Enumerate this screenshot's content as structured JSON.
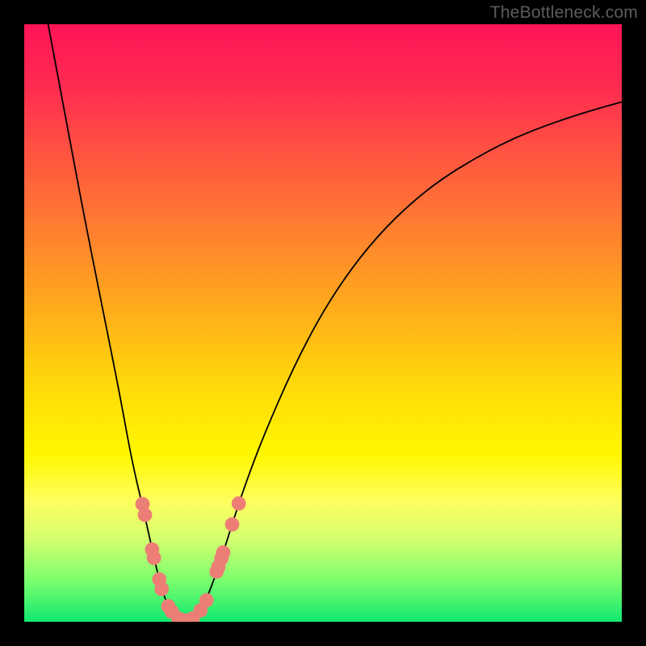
{
  "watermark": "TheBottleneck.com",
  "colors": {
    "frame": "#000000",
    "curve_stroke": "#000000",
    "marker_fill": "#ed7e76",
    "gradient_stops": [
      "#ff1456",
      "#ff2a52",
      "#ff5540",
      "#ff7a32",
      "#ffa31f",
      "#ffd80a",
      "#fff700",
      "#fdff60",
      "#d5ff6e",
      "#7cff6e",
      "#10e86f"
    ]
  },
  "chart_data": {
    "type": "line",
    "title": "",
    "xlabel": "",
    "ylabel": "",
    "xlim": [
      0,
      100
    ],
    "ylim": [
      0,
      100
    ],
    "grid": false,
    "curve": [
      {
        "x": 4,
        "y": 100
      },
      {
        "x": 7,
        "y": 84
      },
      {
        "x": 10,
        "y": 68
      },
      {
        "x": 13,
        "y": 53
      },
      {
        "x": 16,
        "y": 38
      },
      {
        "x": 18,
        "y": 27
      },
      {
        "x": 20,
        "y": 18.5
      },
      {
        "x": 22,
        "y": 9.5
      },
      {
        "x": 23,
        "y": 5.5
      },
      {
        "x": 24,
        "y": 2.8
      },
      {
        "x": 25,
        "y": 1.2
      },
      {
        "x": 26,
        "y": 0.4
      },
      {
        "x": 27,
        "y": 0.15
      },
      {
        "x": 28,
        "y": 0.4
      },
      {
        "x": 29,
        "y": 1.3
      },
      {
        "x": 30,
        "y": 2.8
      },
      {
        "x": 31,
        "y": 5.0
      },
      {
        "x": 33,
        "y": 10.6
      },
      {
        "x": 35,
        "y": 17.0
      },
      {
        "x": 37,
        "y": 23.0
      },
      {
        "x": 40,
        "y": 31.0
      },
      {
        "x": 45,
        "y": 42.5
      },
      {
        "x": 50,
        "y": 52.0
      },
      {
        "x": 55,
        "y": 59.5
      },
      {
        "x": 60,
        "y": 65.5
      },
      {
        "x": 65,
        "y": 70.3
      },
      {
        "x": 70,
        "y": 74.2
      },
      {
        "x": 75,
        "y": 77.3
      },
      {
        "x": 80,
        "y": 80.0
      },
      {
        "x": 85,
        "y": 82.2
      },
      {
        "x": 90,
        "y": 84.0
      },
      {
        "x": 95,
        "y": 85.6
      },
      {
        "x": 100,
        "y": 87.0
      }
    ],
    "markers": [
      {
        "x": 19.8,
        "y": 19.7
      },
      {
        "x": 20.2,
        "y": 17.9
      },
      {
        "x": 21.4,
        "y": 12.1
      },
      {
        "x": 21.7,
        "y": 10.7
      },
      {
        "x": 22.6,
        "y": 7.1
      },
      {
        "x": 23.0,
        "y": 5.5
      },
      {
        "x": 24.1,
        "y": 2.6
      },
      {
        "x": 24.7,
        "y": 1.7
      },
      {
        "x": 25.8,
        "y": 0.55
      },
      {
        "x": 26.2,
        "y": 0.35
      },
      {
        "x": 26.6,
        "y": 0.22
      },
      {
        "x": 27.0,
        "y": 0.15
      },
      {
        "x": 27.4,
        "y": 0.22
      },
      {
        "x": 27.8,
        "y": 0.35
      },
      {
        "x": 28.2,
        "y": 0.55
      },
      {
        "x": 29.5,
        "y": 1.9
      },
      {
        "x": 30.5,
        "y": 3.6
      },
      {
        "x": 32.2,
        "y": 8.4
      },
      {
        "x": 32.5,
        "y": 9.2
      },
      {
        "x": 33.0,
        "y": 10.6
      },
      {
        "x": 33.3,
        "y": 11.6
      },
      {
        "x": 34.8,
        "y": 16.3
      },
      {
        "x": 35.9,
        "y": 19.8
      }
    ],
    "marker_r_domain": 1.2
  }
}
